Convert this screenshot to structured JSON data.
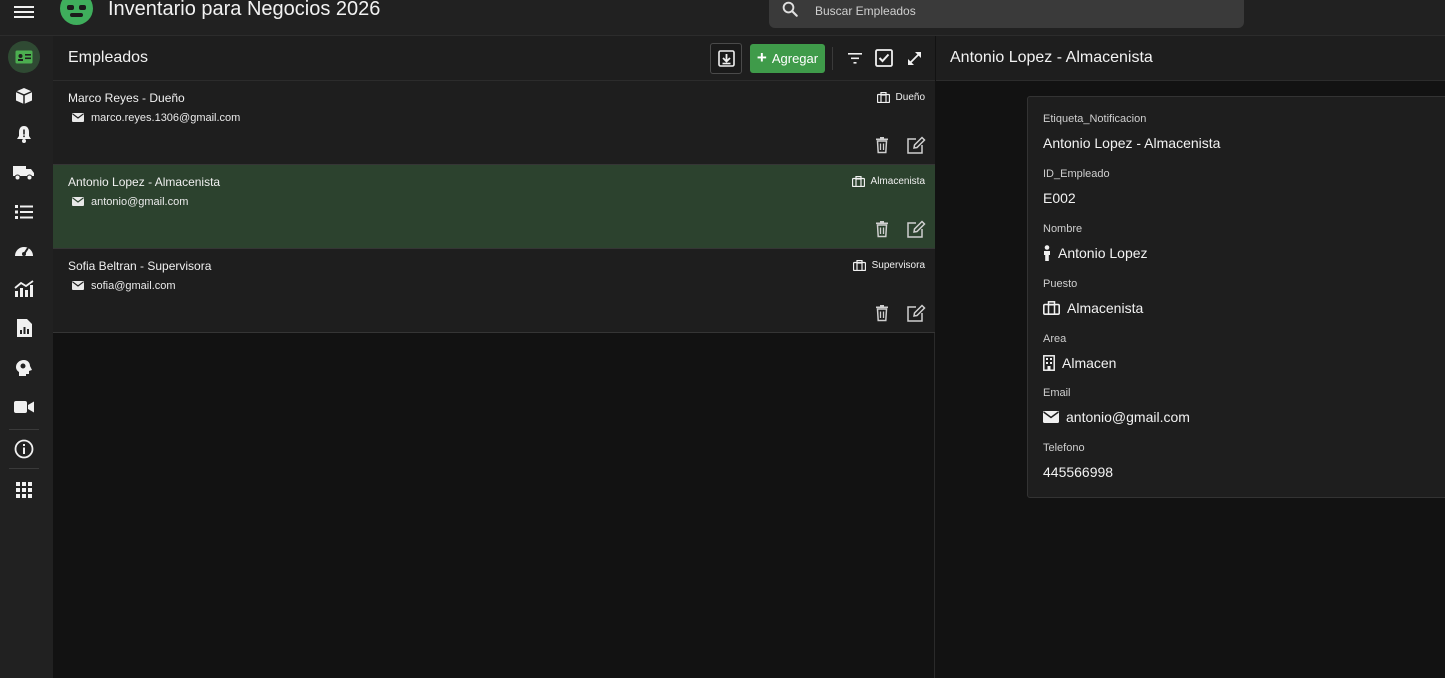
{
  "app": {
    "title": "Inventario para Negocios 2026"
  },
  "search": {
    "placeholder": "Buscar Empleados"
  },
  "sidebar": {
    "items": [
      {
        "name": "employees",
        "icon": "id-card-icon",
        "active": true
      },
      {
        "name": "products",
        "icon": "box-icon"
      },
      {
        "name": "alerts",
        "icon": "bell-icon"
      },
      {
        "name": "deliveries",
        "icon": "truck-icon"
      },
      {
        "name": "lists",
        "icon": "list-icon"
      },
      {
        "name": "dashboard",
        "icon": "gauge-icon"
      },
      {
        "name": "analytics",
        "icon": "chart-icon"
      },
      {
        "name": "reports",
        "icon": "report-icon"
      },
      {
        "name": "ideas",
        "icon": "brain-icon"
      },
      {
        "name": "video",
        "icon": "video-icon"
      },
      {
        "name": "info",
        "icon": "info-icon"
      },
      {
        "name": "apps",
        "icon": "grid-icon"
      }
    ]
  },
  "list": {
    "title": "Empleados",
    "add_label": "Agregar",
    "rows": [
      {
        "title": "Marco Reyes - Dueño",
        "email": "marco.reyes.1306@gmail.com",
        "badge": "Dueño"
      },
      {
        "title": "Antonio Lopez - Almacenista",
        "email": "antonio@gmail.com",
        "badge": "Almacenista"
      },
      {
        "title": "Sofia Beltran - Supervisora",
        "email": "sofia@gmail.com",
        "badge": "Supervisora"
      }
    ]
  },
  "detail": {
    "title": "Antonio Lopez - Almacenista",
    "fields": [
      {
        "label": "Etiqueta_Notificacion",
        "value": "Antonio Lopez - Almacenista",
        "icon": ""
      },
      {
        "label": "ID_Empleado",
        "value": "E002",
        "icon": ""
      },
      {
        "label": "Nombre",
        "value": "Antonio Lopez",
        "icon": "person-icon"
      },
      {
        "label": "Puesto",
        "value": "Almacenista",
        "icon": "briefcase-icon"
      },
      {
        "label": "Area",
        "value": "Almacen",
        "icon": "building-icon"
      },
      {
        "label": "Email",
        "value": "antonio@gmail.com",
        "icon": "envelope-icon"
      },
      {
        "label": "Telefono",
        "value": "445566998",
        "icon": ""
      }
    ]
  },
  "colors": {
    "accent": "#3f9b4a",
    "selected_row": "#2c422e",
    "background": "#121212",
    "panel": "#1e1e1e"
  }
}
